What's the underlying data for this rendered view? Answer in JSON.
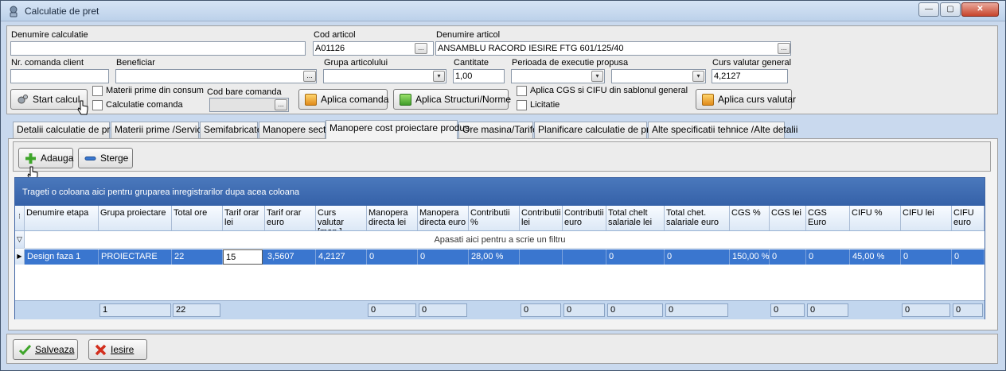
{
  "window": {
    "title": "Calculatie de pret",
    "min": "—",
    "max": "▢",
    "close": "✕"
  },
  "form": {
    "denumire_calculatie": {
      "label": "Denumire calculatie",
      "value": ""
    },
    "cod_articol": {
      "label": "Cod articol",
      "value": "A01126"
    },
    "denumire_articol": {
      "label": "Denumire articol",
      "value": "ANSAMBLU RACORD IESIRE FTG 601/125/40"
    },
    "nr_comanda_client": {
      "label": "Nr. comanda client",
      "value": ""
    },
    "beneficiar": {
      "label": "Beneficiar",
      "value": ""
    },
    "grupa_articolului": {
      "label": "Grupa articolului",
      "value": ""
    },
    "cantitate": {
      "label": "Cantitate",
      "value": "1,00"
    },
    "perioada": {
      "label": "Perioada de executie propusa",
      "value1": "",
      "value2": ""
    },
    "curs_valutar": {
      "label": "Curs valutar general",
      "value": "4,2127"
    },
    "cod_bare": {
      "label": "Cod bare comanda",
      "value": ""
    },
    "ellipsis": "...",
    "dropdown_arrow": "▾"
  },
  "checkboxes": {
    "materii_prime": "Materii prime din consum",
    "calculatie_comanda": "Calculatie comanda",
    "aplica_cgs": "Aplica CGS si CIFU din sablonul general",
    "licitatie": "Licitatie"
  },
  "buttons": {
    "start_calcul": "Start calcul",
    "aplica_comanda": "Aplica comanda",
    "aplica_structuri": "Aplica Structuri/Norme",
    "aplica_curs": "Aplica curs valutar",
    "adauga": "Adauga",
    "sterge": "Sterge",
    "salveaza": "Salveaza",
    "iesire": "Iesire"
  },
  "tabs": [
    "Detalii calculatie de pret",
    "Materii prime /Servicii",
    "Semifabricate",
    "Manopere sectii",
    "Manopere cost proiectare produs",
    "Ore masina/Tarife",
    "Planificare calculatie de pret",
    "Alte specificatii tehnice /Alte detalii"
  ],
  "grid": {
    "group_hint": "Trageti o coloana aici pentru gruparea inregistrarilor dupa acea coloana",
    "filter_hint": "Apasati aici pentru a scrie un filtru",
    "columns": [
      "Denumire etapa",
      "Grupa proiectare",
      "Total ore",
      "Tarif orar lei",
      "Tarif orar euro",
      "Curs valutar [man.]",
      "Manopera directa lei",
      "Manopera directa euro",
      "Contributii %",
      "Contributii lei",
      "Contributii euro",
      "Total  chelt salariale lei",
      "Total chet. salariale euro",
      "CGS %",
      "CGS lei",
      "CGS Euro",
      "CIFU %",
      "CIFU lei",
      "CIFU euro"
    ],
    "rows": [
      [
        "Design faza 1",
        "PROIECTARE",
        "22",
        "15",
        "3,5607",
        "4,2127",
        "0",
        "0",
        "28,00 %",
        "",
        "",
        "0",
        "0",
        "150,00 %",
        "0",
        "0",
        "45,00 %",
        "0",
        "0"
      ]
    ],
    "footer": [
      "",
      "1",
      "22",
      "",
      "",
      "",
      "0",
      "0",
      "",
      "0",
      "0",
      "0",
      "0",
      "",
      "0",
      "0",
      "",
      "0",
      "0"
    ]
  }
}
